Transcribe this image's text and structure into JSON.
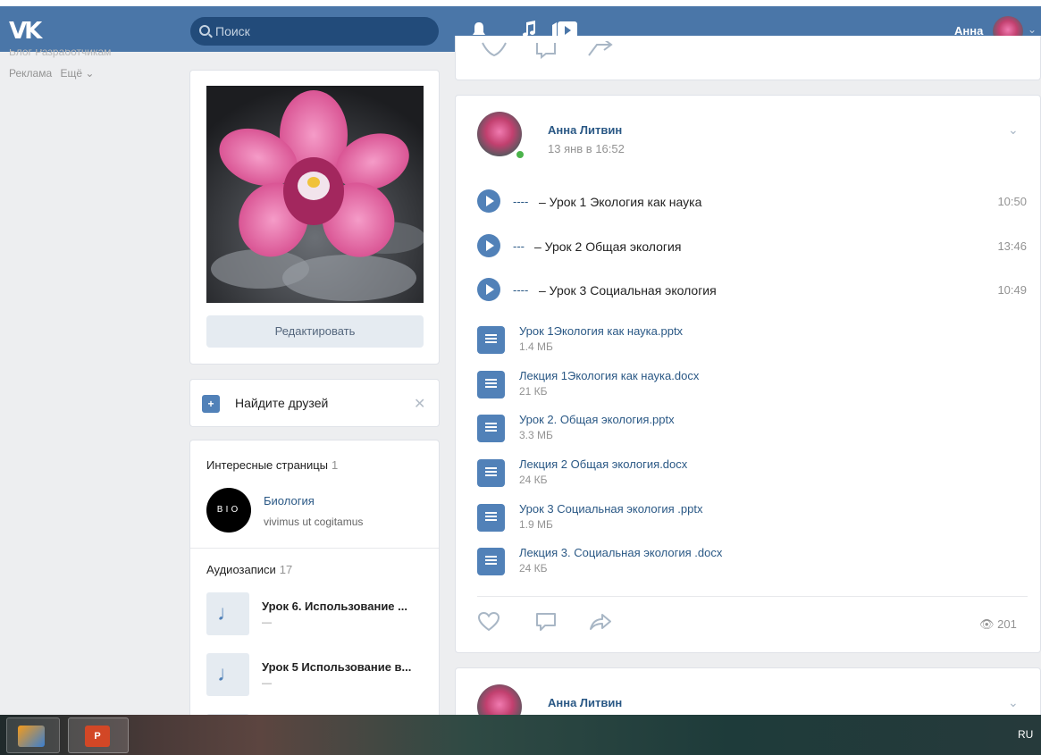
{
  "header": {
    "logo": "VK",
    "search_placeholder": "Поиск",
    "user_name": "Анна"
  },
  "leftnav": {
    "row1": "Блог   Разработчикам",
    "links": [
      "Реклама",
      "Ещё ⌄"
    ]
  },
  "profile": {
    "edit_label": "Редактировать"
  },
  "friends": {
    "label": "Найдите друзей"
  },
  "pages": {
    "title": "Интересные страницы",
    "count": "1",
    "item": {
      "avatar_text": "BIO",
      "name": "Биология",
      "subtitle": "vivimus ut cogitamus"
    }
  },
  "audio": {
    "title": "Аудиозаписи",
    "count": "17",
    "items": [
      {
        "name": "Урок 6. Использование ...",
        "sub": "—"
      },
      {
        "name": "Урок 5 Использование в...",
        "sub": "—"
      }
    ]
  },
  "post": {
    "author": "Анна Литвин",
    "date": "13 янв в 16:52",
    "tracks": [
      {
        "artist": "----",
        "title": "–  Урок 1 Экология как наука",
        "duration": "10:50"
      },
      {
        "artist": "---",
        "title": "–  Урок 2 Общая экология",
        "duration": "13:46"
      },
      {
        "artist": "----",
        "title": "–  Урок 3 Социальная экология",
        "duration": "10:49"
      }
    ],
    "docs": [
      {
        "name": "Урок 1Экология как наука.pptx",
        "size": "1.4 МБ"
      },
      {
        "name": "Лекция 1Экология как наука.docx",
        "size": "21 КБ"
      },
      {
        "name": "Урок 2. Общая экология.pptx",
        "size": "3.3 МБ"
      },
      {
        "name": "Лекция 2 Общая экология.docx",
        "size": "24 КБ"
      },
      {
        "name": "Урок 3 Социальная экология .pptx",
        "size": "1.9 МБ"
      },
      {
        "name": "Лекция 3. Социальная экология .docx",
        "size": "24 КБ"
      }
    ],
    "views": "201"
  },
  "post2": {
    "author": "Анна Литвин"
  },
  "taskbar": {
    "lang": "RU"
  },
  "colors": {
    "header": "#4a76a8",
    "link": "#2a5885",
    "accent": "#5181b8",
    "online": "#4bb34b"
  }
}
